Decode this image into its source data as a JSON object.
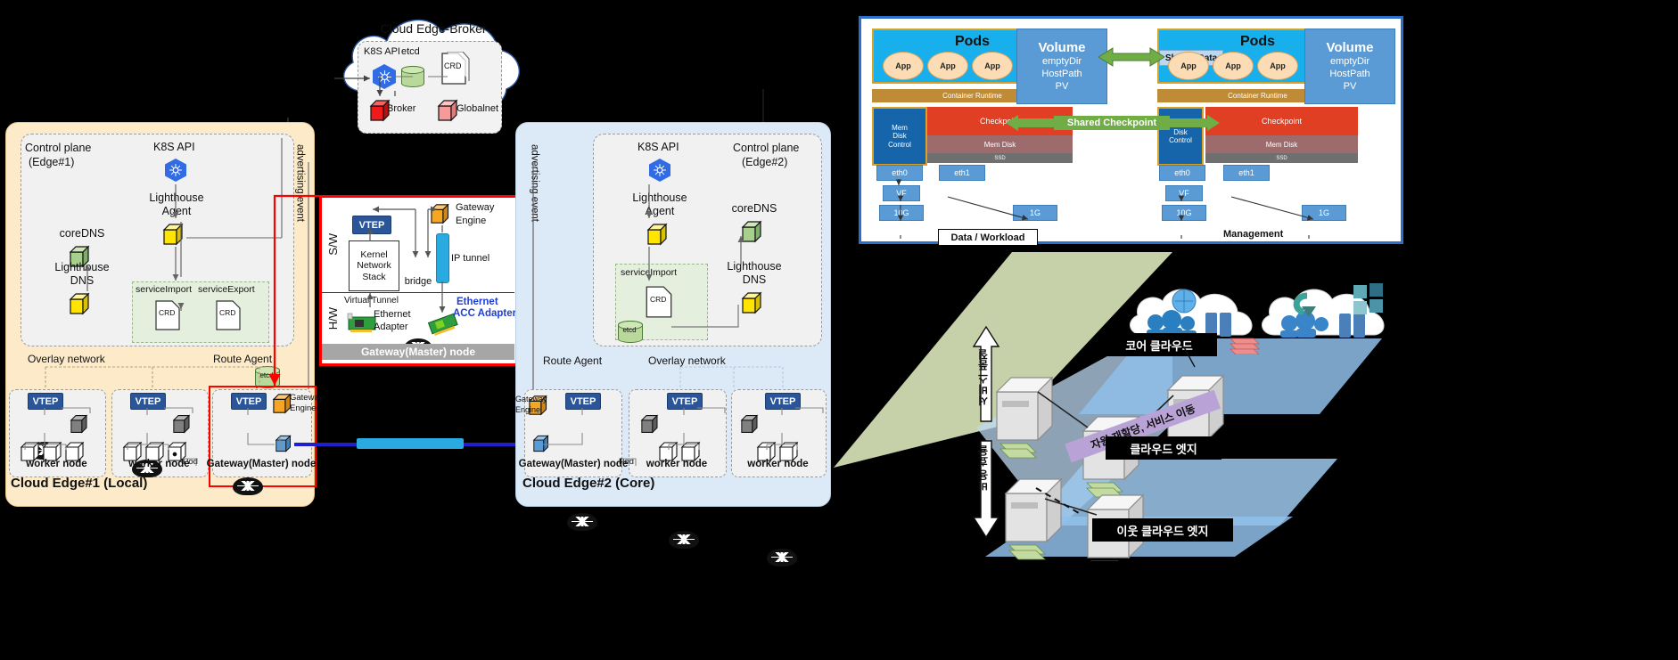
{
  "cloud": {
    "title": "Cloud Edge-Broker",
    "k8s_api": "K8S API",
    "etcd": "etcd",
    "crd": "CRD",
    "broker": "Broker",
    "globalnet": "Globalnet"
  },
  "edge1": {
    "title": "Cloud Edge#1 (Local)",
    "control_plane": "Control plane\n(Edge#1)",
    "control_plane_l1": "Control plane",
    "control_plane_l2": "(Edge#1)",
    "k8s_api": "K8S API",
    "lighthouse_agent_l1": "Lighthouse",
    "lighthouse_agent_l2": "Agent",
    "coredns": "coreDNS",
    "lighthouse_dns_l1": "Lighthouse",
    "lighthouse_dns_l2": "DNS",
    "service_import": "serviceImport",
    "service_export": "serviceExport",
    "crd": "CRD",
    "etcd": "etcd",
    "advertising_event": "advertising event",
    "overlay_network": "Overlay network",
    "route_agent": "Route Agent",
    "vtep": "VTEP",
    "pod": "Pod",
    "nodes": [
      {
        "label": "worker node"
      },
      {
        "label": "worker node"
      },
      {
        "label": "Gateway(Master) node"
      }
    ],
    "gateway_engine_l1": "Gateway",
    "gateway_engine_l2": "Engine"
  },
  "gatewaydetail": {
    "vtep": "VTEP",
    "sw": "S/W",
    "hw": "H/W",
    "gateway_engine_l1": "Gateway",
    "gateway_engine_l2": "Engine",
    "kernel_l1": "Kernel",
    "kernel_l2": "Network",
    "kernel_l3": "Stack",
    "bridge": "bridge",
    "ip_tunnel": "IP tunnel",
    "virtual_tunnel": "Virtual Tunnel",
    "ethernet_adapter_l1": "Ethernet",
    "ethernet_adapter_l2": "Adapter",
    "acc_l1": "Ethernet",
    "acc_l2": "ACC Adapter",
    "footer": "Gateway(Master) node"
  },
  "edge2": {
    "title": "Cloud Edge#2 (Core)",
    "control_plane_l1": "Control plane",
    "control_plane_l2": "(Edge#2)",
    "k8s_api": "K8S API",
    "lighthouse_agent_l1": "Lighthouse",
    "lighthouse_agent_l2": "Agent",
    "coredns": "coreDNS",
    "lighthouse_dns_l1": "Lighthouse",
    "lighthouse_dns_l2": "DNS",
    "service_import": "serviceImport",
    "crd": "CRD",
    "etcd": "etcd",
    "advertising_event": "advertising event",
    "overlay_network": "Overlay network",
    "route_agent": "Route Agent",
    "vtep": "VTEP",
    "pod": "Pod",
    "gateway_engine_l1": "Gateway",
    "gateway_engine_l2": "Engine",
    "nodes": [
      {
        "label": "Gateway(Master) node"
      },
      {
        "label": "worker node"
      },
      {
        "label": "worker node"
      }
    ]
  },
  "resource_panel": {
    "left": {
      "pods": "Pods",
      "apps": [
        "App",
        "App",
        "App"
      ],
      "container_runtime": "Container Runtime",
      "mem_disk_control_l1": "Mem",
      "mem_disk_control_l2": "Disk",
      "mem_disk_control_l3": "Control",
      "checkpoint": "Checkpoint",
      "mem_disk": "Mem Disk",
      "ssd": "SSD",
      "eth0": "eth0",
      "eth1": "eth1",
      "vf": "VF",
      "tengig": "10G",
      "onegig": "1G",
      "volume_title": "Volume",
      "volume_l1": "emptyDir",
      "volume_l2": "HostPath",
      "volume_l3": "PV"
    },
    "right": {
      "pods": "Pods",
      "shared_data": "Shared Data",
      "apps": [
        "App",
        "App",
        "App"
      ],
      "container_runtime": "Container Runtime",
      "mem_disk_control_l1": "Disk",
      "mem_disk_control_l2": "Control",
      "checkpoint": "Checkpoint",
      "mem_disk": "Mem Disk",
      "ssd": "SSD",
      "eth0": "eth0",
      "eth1": "eth1",
      "vf": "VF",
      "tengig": "10G",
      "onegig": "1G",
      "volume_title": "Volume",
      "volume_l1": "emptyDir",
      "volume_l2": "HostPath",
      "volume_l3": "PV"
    },
    "shared_checkpoint": "Shared Checkpoint",
    "data_workload": "Data / Workload",
    "management": "Management"
  },
  "cloudmap": {
    "core_cloud": "코어 클라우드",
    "cloud_edge": "클라우드 엣지",
    "neighbor_edge": "이웃 클라우드 엣지",
    "vertical_up": "서비스 품질",
    "vertical_down": "비용 효율",
    "diagonal": "자원 재할당, 서비스 이동"
  },
  "colors": {
    "accent_blue": "#2a5699",
    "edge1_bg": "#fdeac9",
    "edge2_bg": "#dce9f7",
    "red_border": "#ff0000",
    "green_arrow": "#70ad47",
    "k8s_blue": "#326ce5",
    "yellow_cube": "#ffe500",
    "orange_cube": "#f5a623"
  }
}
